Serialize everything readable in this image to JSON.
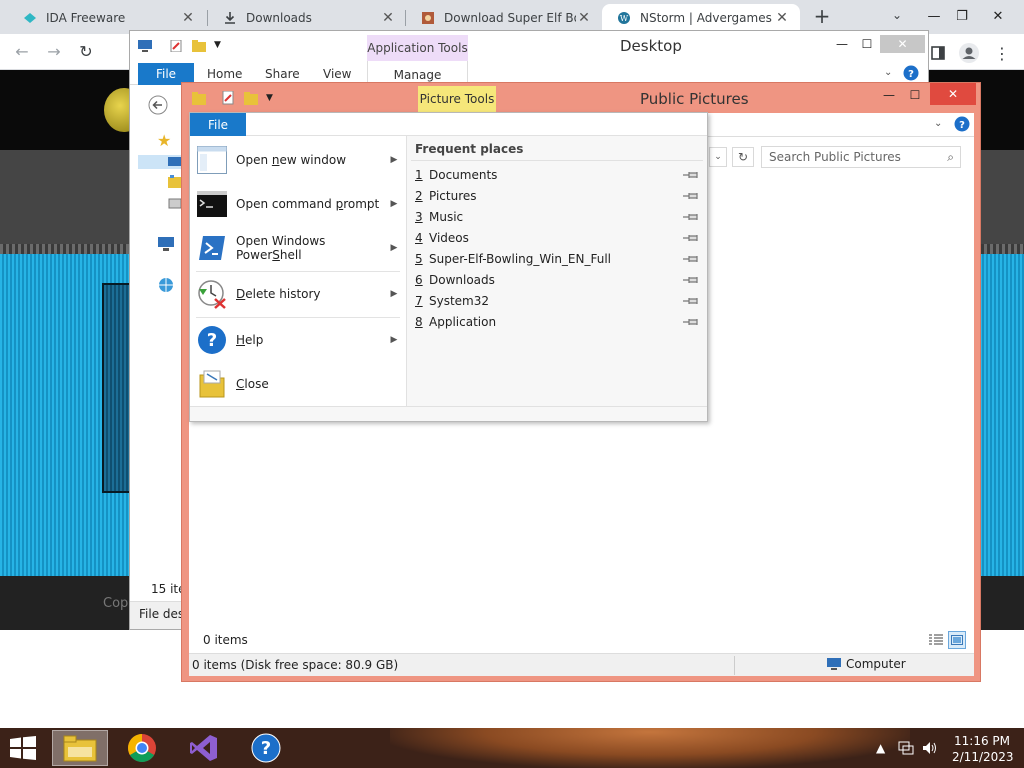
{
  "browser": {
    "tabs": [
      {
        "title": "IDA Freeware",
        "icon": "ida-icon"
      },
      {
        "title": "Downloads",
        "icon": "download-icon"
      },
      {
        "title": "Download Super Elf Bowl",
        "icon": "elf-icon"
      },
      {
        "title": "NStorm | Advergames si",
        "icon": "wordpress-icon"
      }
    ]
  },
  "site": {
    "copyright_text": "Cop"
  },
  "desktop_window": {
    "title": "Desktop",
    "context_tab": "Application Tools",
    "ribbon": {
      "file": "File",
      "home": "Home",
      "share": "Share",
      "view": "View",
      "manage": "Manage"
    },
    "status_count": "15 ite",
    "status_desc": "File desc"
  },
  "pictures_window": {
    "title": "Public Pictures",
    "context_tab": "Picture Tools",
    "search_placeholder": "Search Public Pictures",
    "items_label": "0 items",
    "status_left": "0 items (Disk free space: 80.9 GB)",
    "status_right": "Computer"
  },
  "file_menu": {
    "tab_label": "File",
    "items": [
      {
        "pre": "Open ",
        "key": "n",
        "post": "ew window",
        "has_submenu": true,
        "icon": "new-window-icon"
      },
      {
        "pre": "Open command ",
        "key": "p",
        "post": "rompt",
        "has_submenu": true,
        "icon": "command-prompt-icon"
      },
      {
        "pre": "Open Windows Power",
        "key": "S",
        "post": "hell",
        "has_submenu": true,
        "icon": "powershell-icon"
      },
      {
        "pre": "",
        "key": "D",
        "post": "elete history",
        "has_submenu": true,
        "icon": "delete-history-icon"
      },
      {
        "pre": "",
        "key": "H",
        "post": "elp",
        "has_submenu": true,
        "icon": "help-icon"
      },
      {
        "pre": "",
        "key": "C",
        "post": "lose",
        "has_submenu": false,
        "icon": "close-folder-icon"
      }
    ],
    "frequent_heading": "Frequent places",
    "frequent_places": [
      {
        "num": "1",
        "name": "Documents"
      },
      {
        "num": "2",
        "name": "Pictures"
      },
      {
        "num": "3",
        "name": "Music"
      },
      {
        "num": "4",
        "name": "Videos"
      },
      {
        "num": "5",
        "name": "Super-Elf-Bowling_Win_EN_Full"
      },
      {
        "num": "6",
        "name": "Downloads"
      },
      {
        "num": "7",
        "name": "System32"
      },
      {
        "num": "8",
        "name": "Application"
      }
    ]
  },
  "taskbar": {
    "time": "11:16 PM",
    "date": "2/11/2023"
  },
  "colors": {
    "file_tab_blue": "#1979ca",
    "app_tools_purple": "#eedcf8",
    "picture_tools_yellow": "#f6e77a",
    "pictures_frame": "#ef9582",
    "close_red": "#e04a3f"
  }
}
